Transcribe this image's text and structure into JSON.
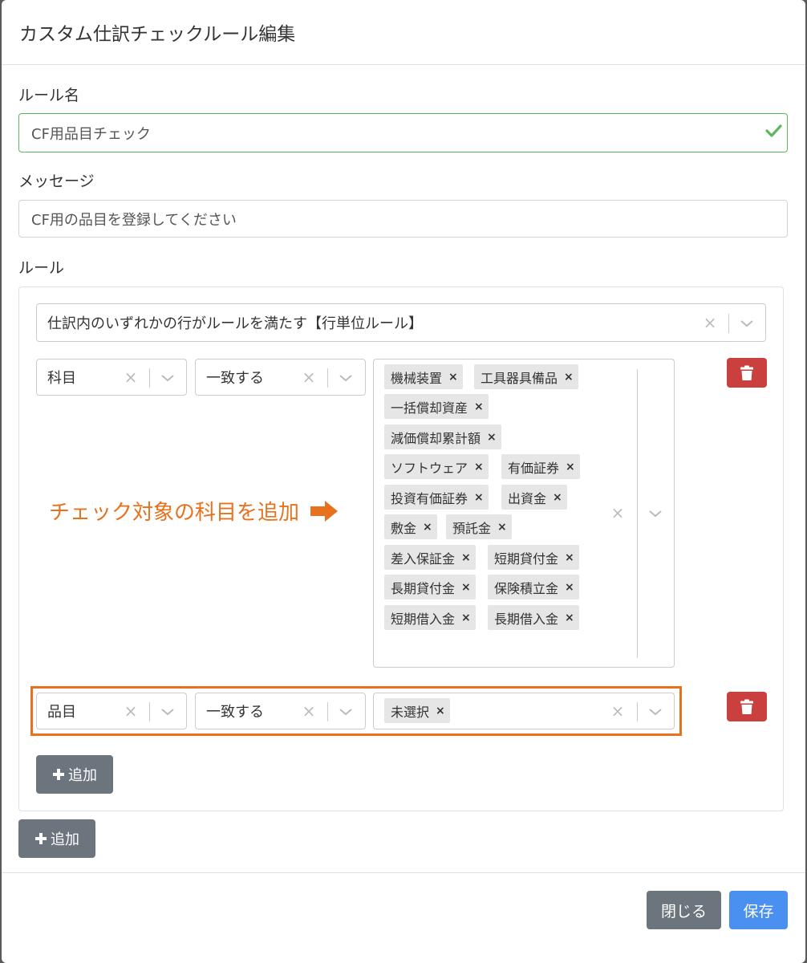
{
  "dialog": {
    "title": "カスタム仕訳チェックルール編集"
  },
  "form": {
    "rule_name_label": "ルール名",
    "rule_name_value": "CF用品目チェック",
    "message_label": "メッセージ",
    "message_value": "CF用の品目を登録してください",
    "rules_label": "ルール"
  },
  "rule_group": {
    "mode_select": "仕訳内のいずれかの行がルールを満たす【行単位ルール】",
    "conditions": [
      {
        "field": "科目",
        "operator": "一致する",
        "values": [
          "機械装置",
          "工具器具備品",
          "一括償却資産",
          "減価償却累計額",
          "ソフトウェア",
          "有価証券",
          "投資有価証券",
          "出資金",
          "敷金",
          "預託金",
          "差入保証金",
          "短期貸付金",
          "長期貸付金",
          "保険積立金",
          "短期借入金",
          "長期借入金"
        ]
      },
      {
        "field": "品目",
        "operator": "一致する",
        "values": [
          "未選択"
        ]
      }
    ],
    "inner_add_label": "追加"
  },
  "outer_add_label": "追加",
  "annotation": {
    "text": "チェック対象の科目を追加"
  },
  "footer": {
    "close_label": "閉じる",
    "save_label": "保存"
  },
  "icons": {
    "valid": "check-icon",
    "clear": "x-icon",
    "dropdown": "chevron-down-icon",
    "delete": "trash-icon",
    "add": "plus-icon",
    "arrow": "arrow-right-icon"
  },
  "colors": {
    "valid_border": "#5cb85c",
    "danger": "#c9403f",
    "secondary": "#6c757d",
    "primary": "#4a90f0",
    "annotation": "#e8711d"
  }
}
